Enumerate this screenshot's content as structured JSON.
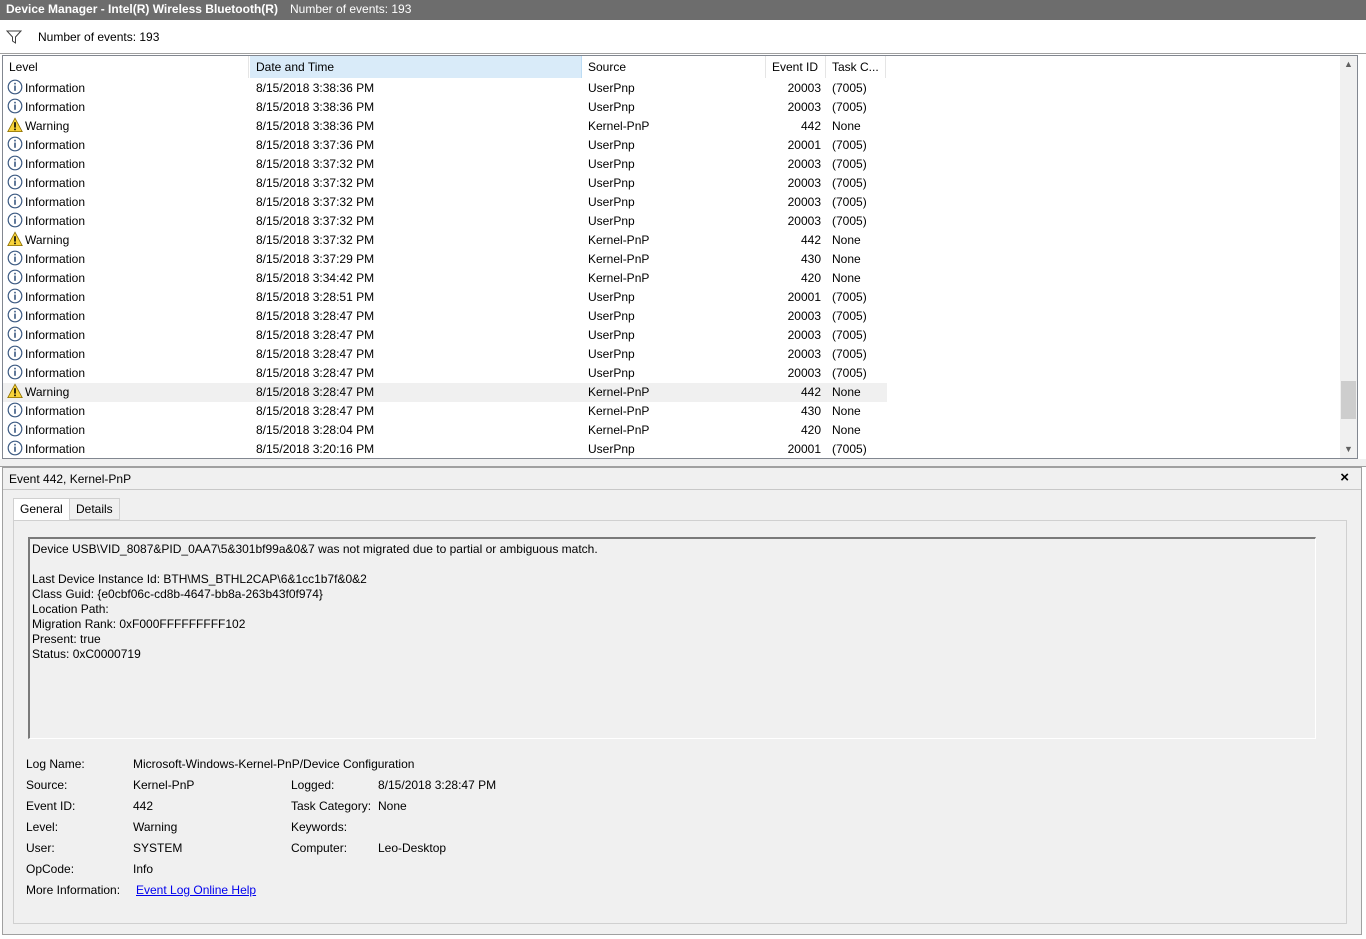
{
  "window": {
    "title": "Device Manager - Intel(R) Wireless Bluetooth(R)",
    "event_count": "Number of events: 193"
  },
  "filter": {
    "text": "Number of events: 193",
    "icon": "filter-icon"
  },
  "columns": [
    "Level",
    "Date and Time",
    "Source",
    "Event ID",
    "Task C..."
  ],
  "rows": [
    {
      "level": "Information",
      "date": "8/15/2018 3:38:36 PM",
      "source": "UserPnp",
      "id": "20003",
      "task": "(7005)"
    },
    {
      "level": "Information",
      "date": "8/15/2018 3:38:36 PM",
      "source": "UserPnp",
      "id": "20003",
      "task": "(7005)"
    },
    {
      "level": "Warning",
      "date": "8/15/2018 3:38:36 PM",
      "source": "Kernel-PnP",
      "id": "442",
      "task": "None"
    },
    {
      "level": "Information",
      "date": "8/15/2018 3:37:36 PM",
      "source": "UserPnp",
      "id": "20001",
      "task": "(7005)"
    },
    {
      "level": "Information",
      "date": "8/15/2018 3:37:32 PM",
      "source": "UserPnp",
      "id": "20003",
      "task": "(7005)"
    },
    {
      "level": "Information",
      "date": "8/15/2018 3:37:32 PM",
      "source": "UserPnp",
      "id": "20003",
      "task": "(7005)"
    },
    {
      "level": "Information",
      "date": "8/15/2018 3:37:32 PM",
      "source": "UserPnp",
      "id": "20003",
      "task": "(7005)"
    },
    {
      "level": "Information",
      "date": "8/15/2018 3:37:32 PM",
      "source": "UserPnp",
      "id": "20003",
      "task": "(7005)"
    },
    {
      "level": "Warning",
      "date": "8/15/2018 3:37:32 PM",
      "source": "Kernel-PnP",
      "id": "442",
      "task": "None"
    },
    {
      "level": "Information",
      "date": "8/15/2018 3:37:29 PM",
      "source": "Kernel-PnP",
      "id": "430",
      "task": "None"
    },
    {
      "level": "Information",
      "date": "8/15/2018 3:34:42 PM",
      "source": "Kernel-PnP",
      "id": "420",
      "task": "None"
    },
    {
      "level": "Information",
      "date": "8/15/2018 3:28:51 PM",
      "source": "UserPnp",
      "id": "20001",
      "task": "(7005)"
    },
    {
      "level": "Information",
      "date": "8/15/2018 3:28:47 PM",
      "source": "UserPnp",
      "id": "20003",
      "task": "(7005)"
    },
    {
      "level": "Information",
      "date": "8/15/2018 3:28:47 PM",
      "source": "UserPnp",
      "id": "20003",
      "task": "(7005)"
    },
    {
      "level": "Information",
      "date": "8/15/2018 3:28:47 PM",
      "source": "UserPnp",
      "id": "20003",
      "task": "(7005)"
    },
    {
      "level": "Information",
      "date": "8/15/2018 3:28:47 PM",
      "source": "UserPnp",
      "id": "20003",
      "task": "(7005)"
    },
    {
      "level": "Warning",
      "date": "8/15/2018 3:28:47 PM",
      "source": "Kernel-PnP",
      "id": "442",
      "task": "None",
      "selected": true
    },
    {
      "level": "Information",
      "date": "8/15/2018 3:28:47 PM",
      "source": "Kernel-PnP",
      "id": "430",
      "task": "None"
    },
    {
      "level": "Information",
      "date": "8/15/2018 3:28:04 PM",
      "source": "Kernel-PnP",
      "id": "420",
      "task": "None"
    },
    {
      "level": "Information",
      "date": "8/15/2018 3:20:16 PM",
      "source": "UserPnp",
      "id": "20001",
      "task": "(7005)"
    }
  ],
  "detail": {
    "title": "Event 442, Kernel-PnP",
    "close": "×",
    "tabs": [
      "General",
      "Details"
    ],
    "message": "Device USB\\VID_8087&PID_0AA7\\5&301bf99a&0&7 was not migrated due to partial or ambiguous match.\n\nLast Device Instance Id: BTH\\MS_BTHL2CAP\\6&1cc1b7f&0&2\nClass Guid: {e0cbf06c-cd8b-4647-bb8a-263b43f0f974}\nLocation Path: \nMigration Rank: 0xF000FFFFFFFFF102\nPresent: true\nStatus: 0xC0000719",
    "props": {
      "log_name_label": "Log Name:",
      "log_name": "Microsoft-Windows-Kernel-PnP/Device Configuration",
      "source_label": "Source:",
      "source": "Kernel-PnP",
      "logged_label": "Logged:",
      "logged": "8/15/2018 3:28:47 PM",
      "event_id_label": "Event ID:",
      "event_id": "442",
      "task_label": "Task Category:",
      "task": "None",
      "level_label": "Level:",
      "level": "Warning",
      "keywords_label": "Keywords:",
      "keywords": "",
      "user_label": "User:",
      "user": "SYSTEM",
      "computer_label": "Computer:",
      "computer": "Leo-Desktop",
      "opcode_label": "OpCode:",
      "opcode": "Info",
      "more_label": "More Information:",
      "more_link": "Event Log Online Help"
    }
  }
}
